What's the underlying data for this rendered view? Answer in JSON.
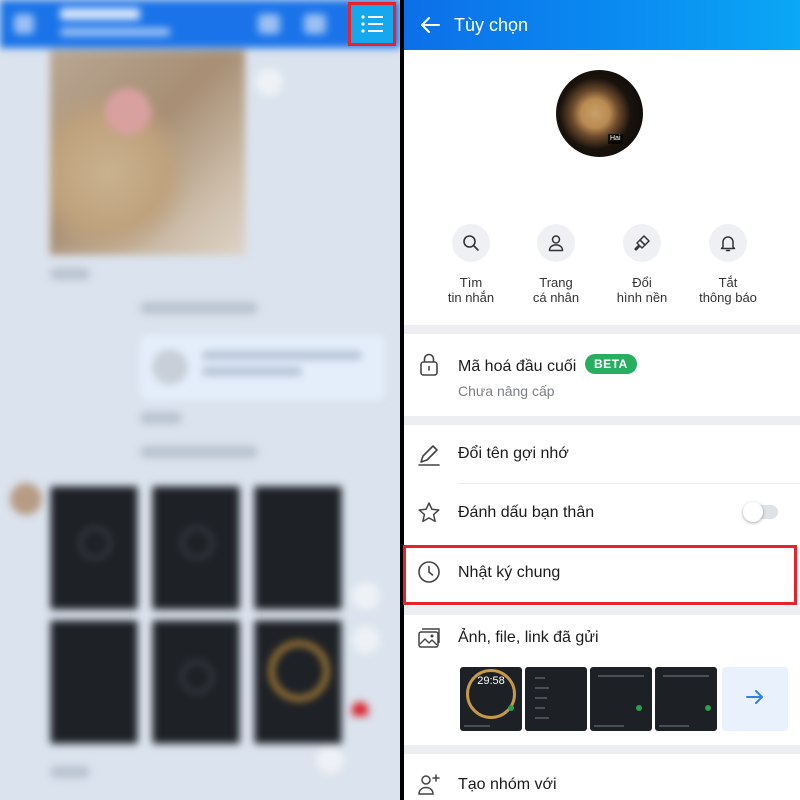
{
  "chat": {
    "menu_icon": "list-icon"
  },
  "options": {
    "title": "Tùy chọn",
    "back_icon": "arrow-left-icon",
    "avatar_tag": "Hai",
    "quick_actions": [
      {
        "label": "Tìm\ntin nhắn",
        "icon": "search-icon"
      },
      {
        "label": "Trang\ncá nhân",
        "icon": "user-icon"
      },
      {
        "label": "Đổi\nhình nền",
        "icon": "paint-brush-icon"
      },
      {
        "label": "Tắt\nthông báo",
        "icon": "bell-icon"
      }
    ],
    "encryption": {
      "label": "Mã hoá đầu cuối",
      "badge": "BETA",
      "sub": "Chưa nâng cấp",
      "icon": "lock-icon"
    },
    "rename": {
      "label": "Đổi tên gợi nhớ",
      "icon": "pencil-icon"
    },
    "best_friend": {
      "label": "Đánh dấu bạn thân",
      "icon": "star-icon",
      "toggle_on": false
    },
    "timeline": {
      "label": "Nhật ký chung",
      "icon": "clock-icon"
    },
    "media": {
      "label": "Ảnh, file, link đã gửi",
      "icon": "images-icon",
      "thumb_clock": "29:58",
      "more_icon": "arrow-right-icon"
    },
    "create_group": {
      "label": "Tạo nhóm với",
      "icon": "add-user-icon"
    }
  },
  "colors": {
    "header_blue": "#0c6fe8",
    "highlight_red": "#e8222b",
    "beta_green": "#27ae60",
    "menu_button_blue": "#15a8ef"
  }
}
